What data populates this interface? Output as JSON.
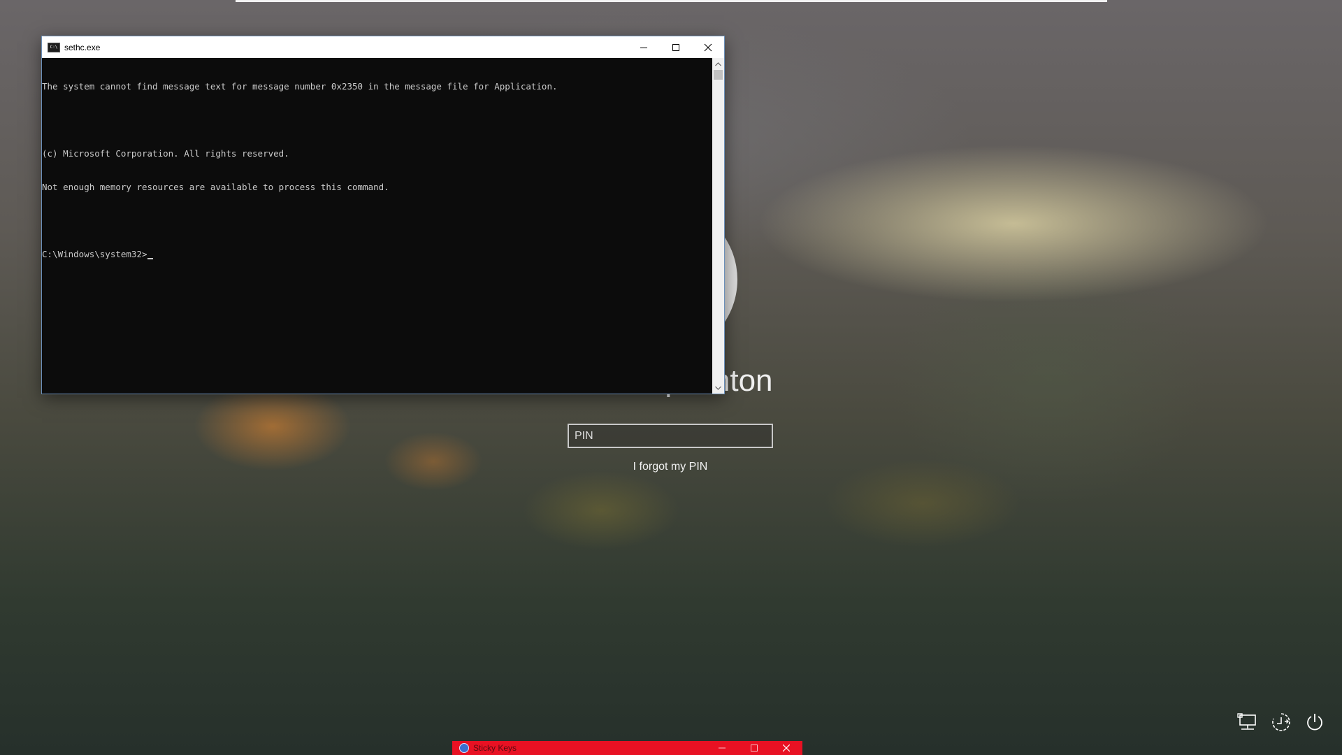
{
  "lock_screen": {
    "user_name": "Desktop-Anton",
    "pin_placeholder": "PIN",
    "pin_value": "",
    "forgot_pin": "I forgot my PIN",
    "system_icons": [
      "network-icon",
      "ease-of-access-icon",
      "power-icon"
    ]
  },
  "cmd_window": {
    "title": "sethc.exe",
    "icon_label": "C:\\",
    "lines": [
      "The system cannot find message text for message number 0x2350 in the message file for Application.",
      "",
      "(c) Microsoft Corporation. All rights reserved.",
      "Not enough memory resources are available to process this command.",
      "",
      "C:\\Windows\\system32>"
    ],
    "buttons": [
      "minimize",
      "maximize",
      "close"
    ]
  },
  "sticky_keys": {
    "title": "Sticky Keys",
    "title_color": "#e81123"
  }
}
